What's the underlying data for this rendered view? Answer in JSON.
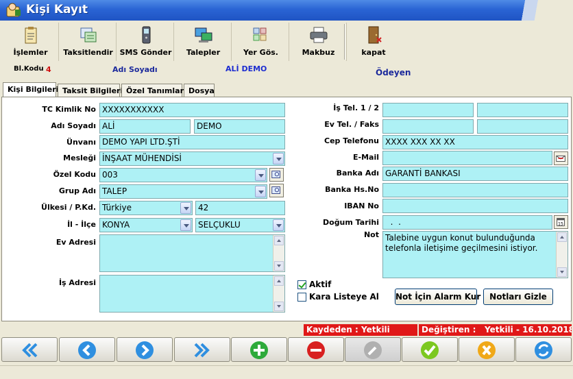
{
  "window": {
    "title": "Kişi Kayıt"
  },
  "toolbar": {
    "islemler": "İşlemler",
    "taksitlendir": "Taksitlendir",
    "sms": "SMS Gönder",
    "talepler": "Talepler",
    "yergos": "Yer Gös.",
    "makbuz": "Makbuz",
    "kapat": "kapat"
  },
  "info": {
    "blkodu_label": "Bl.Kodu",
    "blkodu_value": "4",
    "adsoyad_label": "Adı Soyadı",
    "adsoyad_value": "ALİ DEMO",
    "status_value": "Ödeyen"
  },
  "tabs": [
    "Kişi Bilgileri",
    "Taksit Bilgileri",
    "Özel Tanımlar",
    "Dosya"
  ],
  "form": {
    "tc_label": "TC Kimlik No",
    "tc_value": "XXXXXXXXXXX",
    "ad_label": "Adı Soyadı",
    "ad_value": "ALİ",
    "soyad_value": "DEMO",
    "unvan_label": "Ünvanı",
    "unvan_value": "DEMO YAPI LTD.ŞTİ",
    "meslek_label": "Mesleği",
    "meslek_value": "İNŞAAT MÜHENDİSİ",
    "ozelkod_label": "Özel Kodu",
    "ozelkod_value": "003",
    "grup_label": "Grup Adı",
    "grup_value": "TALEP",
    "ulke_label": "Ülkesi / P.Kd.",
    "ulke_value": "Türkiye",
    "pk_value": "42",
    "il_label": "İl - İlçe",
    "il_value": "KONYA",
    "ilce_value": "SELÇUKLU",
    "evadres_label": "Ev Adresi",
    "isadres_label": "İş Adresi",
    "istel_label": "İş Tel. 1 / 2",
    "evtel_label": "Ev Tel. / Faks",
    "cep_label": "Cep Telefonu",
    "cep_value": "XXXX XXX XX XX",
    "email_label": "E-Mail",
    "banka_label": "Banka Adı",
    "banka_value": "GARANTİ BANKASI",
    "hesap_label": "Banka Hs.No",
    "iban_label": "IBAN No",
    "dogum_label": "Doğum Tarihi",
    "dogum_value": "  .  .",
    "not_label": "Not",
    "not_value": "Talebine uygun konut bulunduğunda telefonla iletişime geçilmesini istiyor.",
    "aktif_label": "Aktif",
    "kara_label": "Kara Listeye Al",
    "alarm_button": "Not İçin Alarm Kur",
    "gizle_button": "Notları Gizle"
  },
  "status": {
    "kaydeden": "Kaydeden : Yetkili",
    "degistiren": "Değiştiren :",
    "degistiren_value": "Yetkili - 16.10.2018"
  },
  "colors": {
    "field_bg": "#aef1f5",
    "status_red": "#e01818",
    "accent_blue": "#1f54c4"
  },
  "nav_icons": [
    "first-icon",
    "previous-icon",
    "next-icon",
    "last-icon",
    "add-icon",
    "delete-icon",
    "edit-icon",
    "save-icon",
    "cancel-icon",
    "refresh-icon"
  ]
}
